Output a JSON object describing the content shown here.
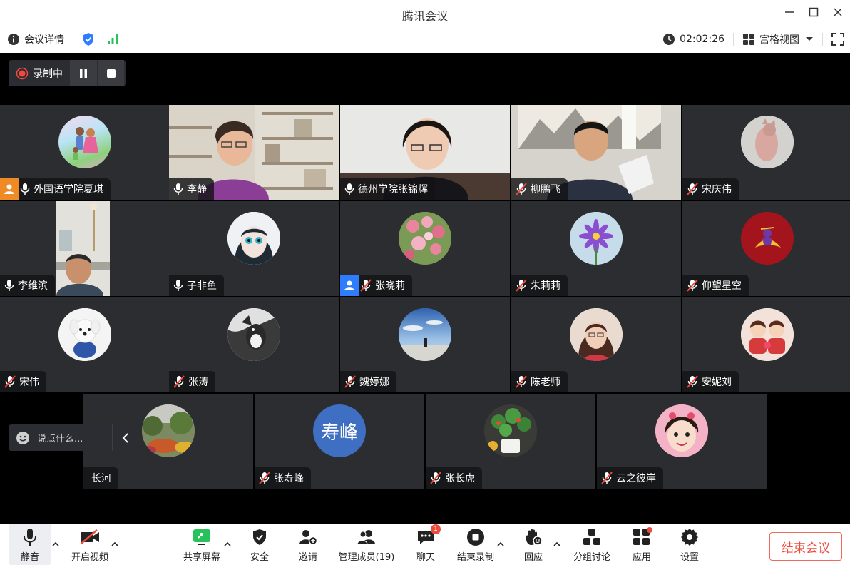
{
  "window": {
    "title": "腾讯会议"
  },
  "infobar": {
    "details_label": "会议详情",
    "timer": "02:02:26",
    "view_label": "宫格视图"
  },
  "recording": {
    "label": "录制中"
  },
  "chat": {
    "placeholder": "说点什么..."
  },
  "participants": [
    {
      "name": "外国语学院夏琪",
      "mic": "on",
      "host": "orange"
    },
    {
      "name": "李静",
      "mic": "on"
    },
    {
      "name": "德州学院张锦辉",
      "mic": "on",
      "active": true
    },
    {
      "name": "柳鹏飞",
      "mic": "muted"
    },
    {
      "name": "宋庆伟",
      "mic": "muted"
    },
    {
      "name": "李维滨",
      "mic": "on"
    },
    {
      "name": "子非鱼",
      "mic": "on"
    },
    {
      "name": "张晓莉",
      "mic": "muted",
      "host": "blue"
    },
    {
      "name": "朱莉莉",
      "mic": "muted"
    },
    {
      "name": "仰望星空",
      "mic": "muted"
    },
    {
      "name": "宋伟",
      "mic": "muted"
    },
    {
      "name": "张涛",
      "mic": "muted"
    },
    {
      "name": "魏婷娜",
      "mic": "muted"
    },
    {
      "name": "陈老师",
      "mic": "muted"
    },
    {
      "name": "安妮刘",
      "mic": "muted"
    },
    {
      "name": "长河",
      "mic": "none"
    },
    {
      "name": "张寿峰",
      "mic": "muted",
      "avatar_text": "寿峰"
    },
    {
      "name": "张长虎",
      "mic": "muted"
    },
    {
      "name": "云之彼岸",
      "mic": "muted"
    }
  ],
  "toolbar": {
    "mute": "静音",
    "video": "开启视频",
    "share": "共享屏幕",
    "security": "安全",
    "invite": "邀请",
    "members": "管理成员(19)",
    "chat": "聊天",
    "chat_badge": "1",
    "stop_record": "结束录制",
    "react": "回应",
    "breakout": "分组讨论",
    "apps": "应用",
    "settings": "设置",
    "end": "结束会议"
  },
  "colors": {
    "active_border": "#27c35a",
    "end_red": "#f04a3e",
    "tile_bg": "#2b2d31"
  }
}
